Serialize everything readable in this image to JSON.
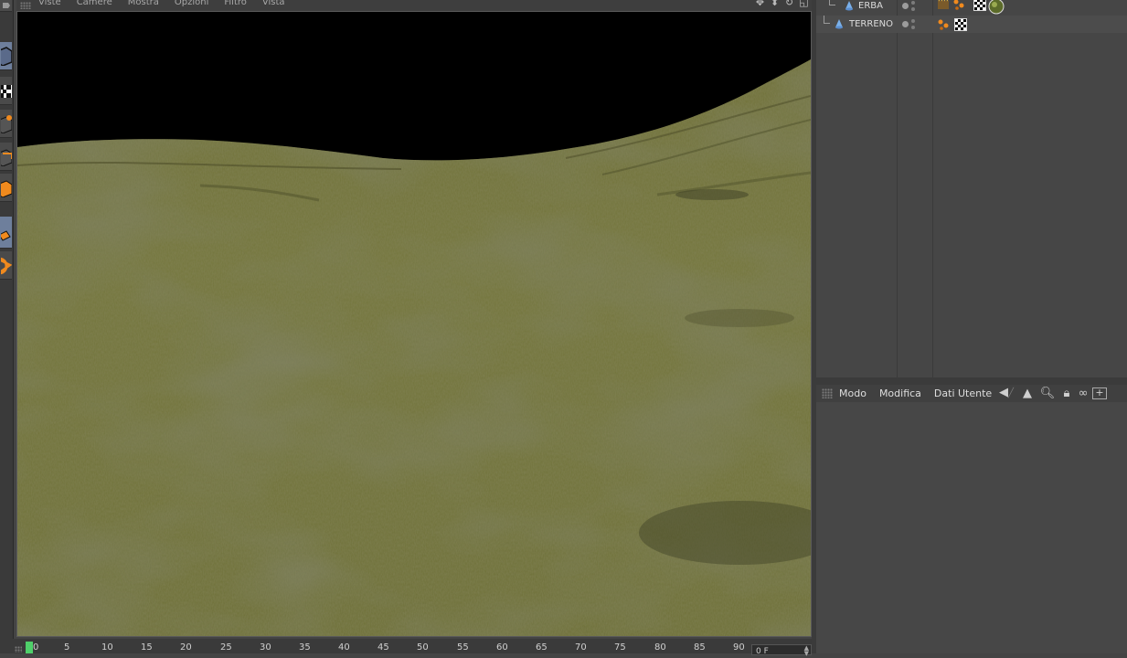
{
  "viewport": {
    "menu": [
      "Viste",
      "Camere",
      "Mostra",
      "Opzioni",
      "Filtro",
      "Vista"
    ],
    "nav_icons": [
      "move-view-icon",
      "zoom-view-icon",
      "rotate-view-icon",
      "toggle-layout-icon"
    ],
    "scene": {
      "sky_color": "#000000",
      "grass_color": "#70703a",
      "grass_dark": "#5a5c30"
    }
  },
  "palette": {
    "tools": [
      "cube-object-icon",
      "checker-texture-icon",
      "cube-axis-icon",
      "polygon-edit-icon",
      "polygon-face-icon",
      "model-mode-icon",
      "rotate-object-icon"
    ]
  },
  "timeline": {
    "ticks": [
      "0",
      "5",
      "10",
      "15",
      "20",
      "25",
      "30",
      "35",
      "40",
      "45",
      "50",
      "55",
      "60",
      "65",
      "70",
      "75",
      "80",
      "85",
      "90"
    ],
    "current_frame": "0",
    "end_field": "0 F"
  },
  "objects": [
    {
      "name": "ERBA",
      "icon": "cone-icon",
      "tags": [
        "hair-tag-icon",
        "dots-tag-icon",
        "checker-material-icon",
        "grass-material-icon"
      ]
    },
    {
      "name": "TERRENO",
      "icon": "cone-icon",
      "tags": [
        "dots-tag-icon",
        "checker-material-icon"
      ]
    }
  ],
  "attributes": {
    "menu": [
      "Modo",
      "Modifica",
      "Dati Utente"
    ],
    "tools": [
      "back-arrow-icon",
      "up-arrow-icon",
      "search-icon",
      "lock-icon",
      "link-icon",
      "new-window-icon"
    ]
  },
  "colors": {
    "panel": "#444444",
    "accent_active": "#6e7f9c",
    "timeline_marker": "#4fd06a"
  }
}
